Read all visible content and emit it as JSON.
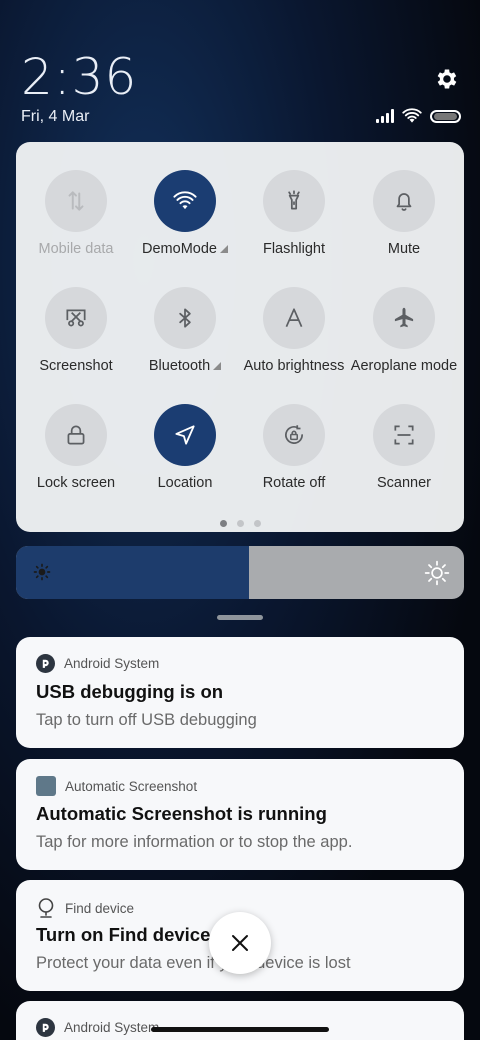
{
  "status": {
    "time": "2:36",
    "date": "Fri, 4 Mar",
    "icons": [
      "signal-icon",
      "wifi-icon",
      "battery-icon"
    ]
  },
  "quick_settings": {
    "tiles": [
      {
        "label": "Mobile data",
        "icon": "mobile-data-icon",
        "active": false,
        "disabled": true
      },
      {
        "label": "DemoMode",
        "icon": "wifi-icon",
        "active": true,
        "expandable": true
      },
      {
        "label": "Flashlight",
        "icon": "flashlight-icon",
        "active": false
      },
      {
        "label": "Mute",
        "icon": "bell-icon",
        "active": false
      },
      {
        "label": "Screenshot",
        "icon": "screenshot-icon",
        "active": false
      },
      {
        "label": "Bluetooth",
        "icon": "bluetooth-icon",
        "active": false,
        "expandable": true
      },
      {
        "label": "Auto brightness",
        "icon": "auto-brightness-icon",
        "active": false
      },
      {
        "label": "Aeroplane mode",
        "icon": "airplane-icon",
        "active": false
      },
      {
        "label": "Lock screen",
        "icon": "lock-icon",
        "active": false
      },
      {
        "label": "Location",
        "icon": "location-icon",
        "active": true
      },
      {
        "label": "Rotate off",
        "icon": "rotate-lock-icon",
        "active": false
      },
      {
        "label": "Scanner",
        "icon": "scanner-icon",
        "active": false
      }
    ],
    "page_indicator": {
      "pages": 3,
      "current": 1
    }
  },
  "brightness": {
    "level": 0.52
  },
  "notifications": [
    {
      "app": "Android System",
      "title": "USB debugging is on",
      "text": "Tap to turn off USB debugging"
    },
    {
      "app": "Automatic Screenshot",
      "title": "Automatic Screenshot is running",
      "text": "Tap for more information or to stop the app."
    },
    {
      "app": "Find device",
      "title": "Turn on Find device",
      "text": "Protect your data even if your device is lost"
    },
    {
      "app": "Android System",
      "title": "",
      "text": ""
    }
  ],
  "colors": {
    "accent": "#1b3d72",
    "panel": "#f0f2f4",
    "tile_inactive": "#d6d8db"
  }
}
